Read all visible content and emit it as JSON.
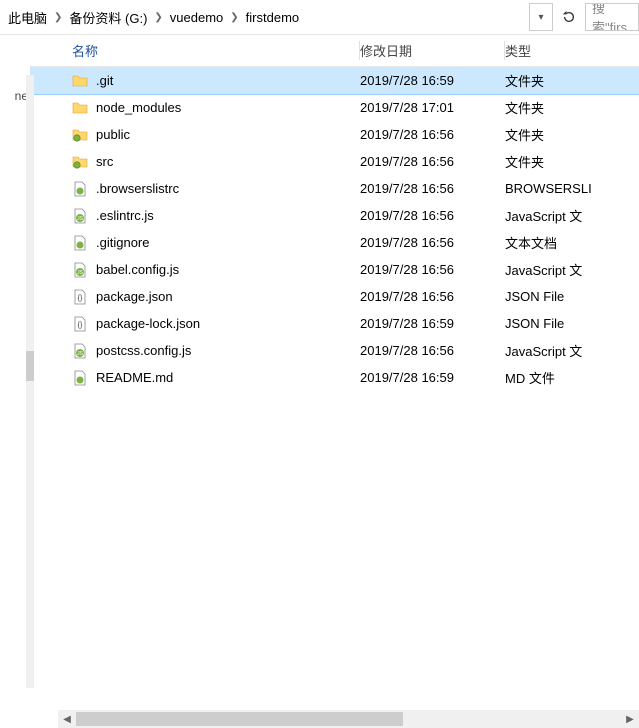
{
  "breadcrumb": {
    "items": [
      {
        "label": "此电脑"
      },
      {
        "label": "备份资料 (G:)"
      },
      {
        "label": "vuedemo"
      },
      {
        "label": "firstdemo"
      }
    ]
  },
  "search": {
    "placeholder": "搜索\"firs"
  },
  "left": {
    "label_fragment": "ne"
  },
  "columns": {
    "name": "名称",
    "date": "修改日期",
    "type": "类型"
  },
  "files": [
    {
      "name": ".git",
      "date": "2019/7/28 16:59",
      "type": "文件夹",
      "icon": "folder",
      "selected": true
    },
    {
      "name": "node_modules",
      "date": "2019/7/28 17:01",
      "type": "文件夹",
      "icon": "folder",
      "selected": false
    },
    {
      "name": "public",
      "date": "2019/7/28 16:56",
      "type": "文件夹",
      "icon": "folder-green",
      "selected": false
    },
    {
      "name": "src",
      "date": "2019/7/28 16:56",
      "type": "文件夹",
      "icon": "folder-green",
      "selected": false
    },
    {
      "name": ".browserslistrc",
      "date": "2019/7/28 16:56",
      "type": "BROWSERSLI",
      "icon": "file-green",
      "selected": false
    },
    {
      "name": ".eslintrc.js",
      "date": "2019/7/28 16:56",
      "type": "JavaScript 文",
      "icon": "file-js",
      "selected": false
    },
    {
      "name": ".gitignore",
      "date": "2019/7/28 16:56",
      "type": "文本文档",
      "icon": "file-green",
      "selected": false
    },
    {
      "name": "babel.config.js",
      "date": "2019/7/28 16:56",
      "type": "JavaScript 文",
      "icon": "file-js",
      "selected": false
    },
    {
      "name": "package.json",
      "date": "2019/7/28 16:56",
      "type": "JSON File",
      "icon": "file-json",
      "selected": false
    },
    {
      "name": "package-lock.json",
      "date": "2019/7/28 16:59",
      "type": "JSON File",
      "icon": "file-json",
      "selected": false
    },
    {
      "name": "postcss.config.js",
      "date": "2019/7/28 16:56",
      "type": "JavaScript 文",
      "icon": "file-js",
      "selected": false
    },
    {
      "name": "README.md",
      "date": "2019/7/28 16:59",
      "type": "MD 文件",
      "icon": "file-green",
      "selected": false
    }
  ]
}
